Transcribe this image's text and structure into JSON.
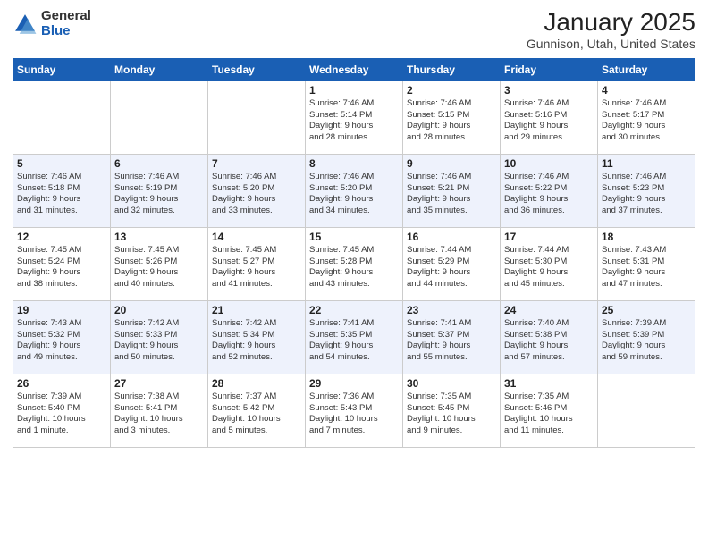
{
  "logo": {
    "general": "General",
    "blue": "Blue"
  },
  "title": "January 2025",
  "location": "Gunnison, Utah, United States",
  "headers": [
    "Sunday",
    "Monday",
    "Tuesday",
    "Wednesday",
    "Thursday",
    "Friday",
    "Saturday"
  ],
  "weeks": [
    [
      {
        "day": "",
        "info": ""
      },
      {
        "day": "",
        "info": ""
      },
      {
        "day": "",
        "info": ""
      },
      {
        "day": "1",
        "info": "Sunrise: 7:46 AM\nSunset: 5:14 PM\nDaylight: 9 hours\nand 28 minutes."
      },
      {
        "day": "2",
        "info": "Sunrise: 7:46 AM\nSunset: 5:15 PM\nDaylight: 9 hours\nand 28 minutes."
      },
      {
        "day": "3",
        "info": "Sunrise: 7:46 AM\nSunset: 5:16 PM\nDaylight: 9 hours\nand 29 minutes."
      },
      {
        "day": "4",
        "info": "Sunrise: 7:46 AM\nSunset: 5:17 PM\nDaylight: 9 hours\nand 30 minutes."
      }
    ],
    [
      {
        "day": "5",
        "info": "Sunrise: 7:46 AM\nSunset: 5:18 PM\nDaylight: 9 hours\nand 31 minutes."
      },
      {
        "day": "6",
        "info": "Sunrise: 7:46 AM\nSunset: 5:19 PM\nDaylight: 9 hours\nand 32 minutes."
      },
      {
        "day": "7",
        "info": "Sunrise: 7:46 AM\nSunset: 5:20 PM\nDaylight: 9 hours\nand 33 minutes."
      },
      {
        "day": "8",
        "info": "Sunrise: 7:46 AM\nSunset: 5:20 PM\nDaylight: 9 hours\nand 34 minutes."
      },
      {
        "day": "9",
        "info": "Sunrise: 7:46 AM\nSunset: 5:21 PM\nDaylight: 9 hours\nand 35 minutes."
      },
      {
        "day": "10",
        "info": "Sunrise: 7:46 AM\nSunset: 5:22 PM\nDaylight: 9 hours\nand 36 minutes."
      },
      {
        "day": "11",
        "info": "Sunrise: 7:46 AM\nSunset: 5:23 PM\nDaylight: 9 hours\nand 37 minutes."
      }
    ],
    [
      {
        "day": "12",
        "info": "Sunrise: 7:45 AM\nSunset: 5:24 PM\nDaylight: 9 hours\nand 38 minutes."
      },
      {
        "day": "13",
        "info": "Sunrise: 7:45 AM\nSunset: 5:26 PM\nDaylight: 9 hours\nand 40 minutes."
      },
      {
        "day": "14",
        "info": "Sunrise: 7:45 AM\nSunset: 5:27 PM\nDaylight: 9 hours\nand 41 minutes."
      },
      {
        "day": "15",
        "info": "Sunrise: 7:45 AM\nSunset: 5:28 PM\nDaylight: 9 hours\nand 43 minutes."
      },
      {
        "day": "16",
        "info": "Sunrise: 7:44 AM\nSunset: 5:29 PM\nDaylight: 9 hours\nand 44 minutes."
      },
      {
        "day": "17",
        "info": "Sunrise: 7:44 AM\nSunset: 5:30 PM\nDaylight: 9 hours\nand 45 minutes."
      },
      {
        "day": "18",
        "info": "Sunrise: 7:43 AM\nSunset: 5:31 PM\nDaylight: 9 hours\nand 47 minutes."
      }
    ],
    [
      {
        "day": "19",
        "info": "Sunrise: 7:43 AM\nSunset: 5:32 PM\nDaylight: 9 hours\nand 49 minutes."
      },
      {
        "day": "20",
        "info": "Sunrise: 7:42 AM\nSunset: 5:33 PM\nDaylight: 9 hours\nand 50 minutes."
      },
      {
        "day": "21",
        "info": "Sunrise: 7:42 AM\nSunset: 5:34 PM\nDaylight: 9 hours\nand 52 minutes."
      },
      {
        "day": "22",
        "info": "Sunrise: 7:41 AM\nSunset: 5:35 PM\nDaylight: 9 hours\nand 54 minutes."
      },
      {
        "day": "23",
        "info": "Sunrise: 7:41 AM\nSunset: 5:37 PM\nDaylight: 9 hours\nand 55 minutes."
      },
      {
        "day": "24",
        "info": "Sunrise: 7:40 AM\nSunset: 5:38 PM\nDaylight: 9 hours\nand 57 minutes."
      },
      {
        "day": "25",
        "info": "Sunrise: 7:39 AM\nSunset: 5:39 PM\nDaylight: 9 hours\nand 59 minutes."
      }
    ],
    [
      {
        "day": "26",
        "info": "Sunrise: 7:39 AM\nSunset: 5:40 PM\nDaylight: 10 hours\nand 1 minute."
      },
      {
        "day": "27",
        "info": "Sunrise: 7:38 AM\nSunset: 5:41 PM\nDaylight: 10 hours\nand 3 minutes."
      },
      {
        "day": "28",
        "info": "Sunrise: 7:37 AM\nSunset: 5:42 PM\nDaylight: 10 hours\nand 5 minutes."
      },
      {
        "day": "29",
        "info": "Sunrise: 7:36 AM\nSunset: 5:43 PM\nDaylight: 10 hours\nand 7 minutes."
      },
      {
        "day": "30",
        "info": "Sunrise: 7:35 AM\nSunset: 5:45 PM\nDaylight: 10 hours\nand 9 minutes."
      },
      {
        "day": "31",
        "info": "Sunrise: 7:35 AM\nSunset: 5:46 PM\nDaylight: 10 hours\nand 11 minutes."
      },
      {
        "day": "",
        "info": ""
      }
    ]
  ]
}
